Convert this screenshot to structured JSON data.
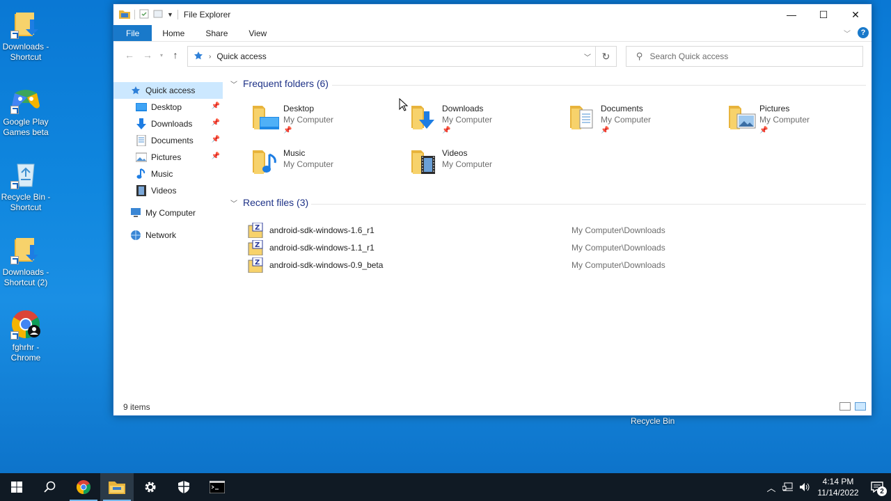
{
  "desktop": {
    "icons": [
      {
        "label": "Downloads - Shortcut"
      },
      {
        "label": "Google Play Games beta"
      },
      {
        "label": "Recycle Bin - Shortcut"
      },
      {
        "label": "Downloads - Shortcut (2)"
      },
      {
        "label": "fghrhr - Chrome"
      }
    ],
    "recycle_bin_label": "Recycle Bin"
  },
  "window": {
    "title": "File Explorer",
    "controls": {
      "minimize": "—",
      "maximize": "☐",
      "close": "✕"
    }
  },
  "ribbon": {
    "tabs": [
      {
        "label": "File"
      },
      {
        "label": "Home"
      },
      {
        "label": "Share"
      },
      {
        "label": "View"
      }
    ],
    "help": "?"
  },
  "address_bar": {
    "path": "Quick access",
    "search_placeholder": "Search Quick access"
  },
  "nav_pane": {
    "quick_access": "Quick access",
    "items": [
      {
        "label": "Desktop",
        "pinned": true
      },
      {
        "label": "Downloads",
        "pinned": true
      },
      {
        "label": "Documents",
        "pinned": true
      },
      {
        "label": "Pictures",
        "pinned": true
      },
      {
        "label": "Music",
        "pinned": false
      },
      {
        "label": "Videos",
        "pinned": false
      }
    ],
    "my_computer": "My Computer",
    "network": "Network"
  },
  "content": {
    "frequent_header": "Frequent folders (6)",
    "frequent_folders": [
      {
        "name": "Desktop",
        "location": "My Computer",
        "pinned": true
      },
      {
        "name": "Downloads",
        "location": "My Computer",
        "pinned": true
      },
      {
        "name": "Documents",
        "location": "My Computer",
        "pinned": true
      },
      {
        "name": "Pictures",
        "location": "My Computer",
        "pinned": true
      },
      {
        "name": "Music",
        "location": "My Computer",
        "pinned": false
      },
      {
        "name": "Videos",
        "location": "My Computer",
        "pinned": false
      }
    ],
    "recent_header": "Recent files (3)",
    "recent_files": [
      {
        "name": "android-sdk-windows-1.6_r1",
        "path": "My Computer\\Downloads"
      },
      {
        "name": "android-sdk-windows-1.1_r1",
        "path": "My Computer\\Downloads"
      },
      {
        "name": "android-sdk-windows-0.9_beta",
        "path": "My Computer\\Downloads"
      }
    ]
  },
  "status_bar": {
    "item_count": "9 items"
  },
  "taskbar": {
    "time": "4:14 PM",
    "date": "11/14/2022",
    "notification_count": "2"
  },
  "colors": {
    "accent": "#1979ca",
    "selection": "#cce8ff",
    "group_header": "#1e3287",
    "folder": "#f3c64a",
    "taskbar": "#101a24"
  }
}
